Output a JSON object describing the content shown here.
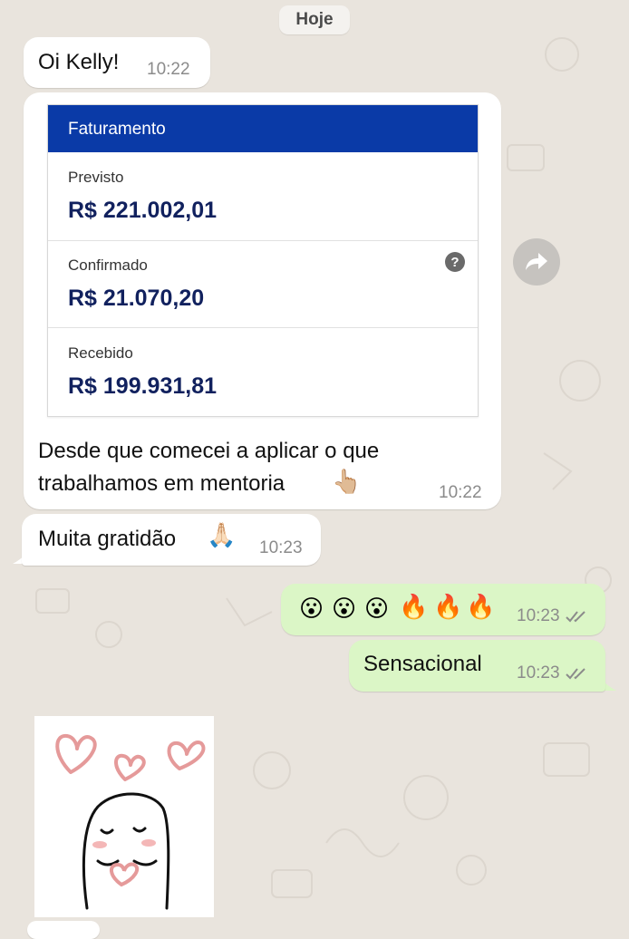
{
  "chat": {
    "date_label": "Hoje",
    "messages": [
      {
        "direction": "in",
        "text": "Oi Kelly!",
        "time": "10:22"
      },
      {
        "direction": "in",
        "type": "image_caption",
        "card": {
          "title": "Faturamento",
          "rows": [
            {
              "label": "Previsto",
              "value": "R$ 221.002,01"
            },
            {
              "label": "Confirmado",
              "value": "R$ 21.070,20"
            },
            {
              "label": "Recebido",
              "value": "R$ 199.931,81"
            }
          ]
        },
        "caption_line1": "Desde que comecei a aplicar o que",
        "caption_line2": "trabalhamos em mentoria",
        "emoji": "👆🏼",
        "time": "10:22"
      },
      {
        "direction": "in",
        "text": "Muita gratidão",
        "emoji": "🙏🏻",
        "time": "10:23"
      },
      {
        "direction": "out",
        "emojis": [
          "😮",
          "😮",
          "😮",
          "🔥",
          "🔥",
          "🔥"
        ],
        "time": "10:23",
        "status": "read"
      },
      {
        "direction": "out",
        "text": "Sensacional",
        "time": "10:23",
        "status": "read"
      },
      {
        "direction": "in",
        "type": "sticker",
        "sticker": "heart-holding-character"
      }
    ]
  },
  "icons": {
    "forward": "forward-arrow-icon",
    "help": "question-icon",
    "read": "double-check-icon"
  },
  "colors": {
    "incoming": "#ffffff",
    "outgoing": "#dbf6c6",
    "card_header": "#0a3aa7",
    "amount": "#11215e",
    "read_ticks": "#8b8b8b"
  }
}
